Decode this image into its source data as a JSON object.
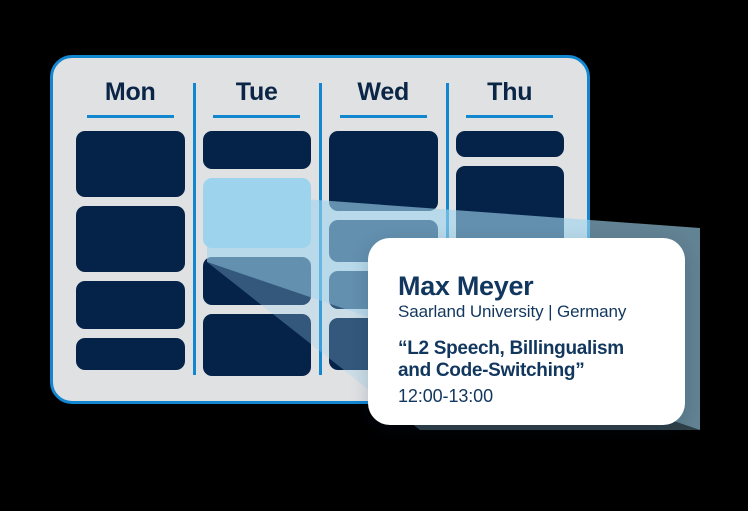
{
  "panel": {
    "name": "weekly-schedule",
    "border_color": "#1287d0",
    "background_color": "#dfe1e3",
    "columns": [
      {
        "day": "Mon",
        "slots": [
          {
            "height": 66,
            "state": "booked"
          },
          {
            "height": 66,
            "state": "booked"
          },
          {
            "height": 48,
            "state": "booked"
          },
          {
            "height": 32,
            "state": "booked"
          }
        ]
      },
      {
        "day": "Tue",
        "slots": [
          {
            "height": 38,
            "state": "booked"
          },
          {
            "height": 70,
            "state": "selected"
          },
          {
            "height": 48,
            "state": "booked"
          },
          {
            "height": 62,
            "state": "booked"
          }
        ]
      },
      {
        "day": "Wed",
        "slots": [
          {
            "height": 80,
            "state": "booked"
          },
          {
            "height": 42,
            "state": "booked"
          },
          {
            "height": 38,
            "state": "booked"
          },
          {
            "height": 52,
            "state": "booked"
          }
        ]
      },
      {
        "day": "Thu",
        "slots": [
          {
            "height": 26,
            "state": "booked"
          },
          {
            "height": 92,
            "state": "booked"
          },
          {
            "height": 44,
            "state": "booked"
          },
          {
            "height": 42,
            "state": "booked"
          }
        ]
      }
    ]
  },
  "beam": {
    "color": "#9ed3ed",
    "from_slot": "Tue-2"
  },
  "tooltip": {
    "speaker_name": "Max Meyer",
    "affiliation": "Saarland University | Germany",
    "talk_title": "“L2 Speech, Billingualism and Code-Switching”",
    "time": "12:00-13:00"
  },
  "colors": {
    "navy": "#052349",
    "text_navy": "#12375f",
    "accent_blue": "#1287d0",
    "light_blue": "#9ed3ed",
    "panel_gray": "#dfe1e3",
    "card_white": "#ffffff",
    "background": "#000000"
  }
}
